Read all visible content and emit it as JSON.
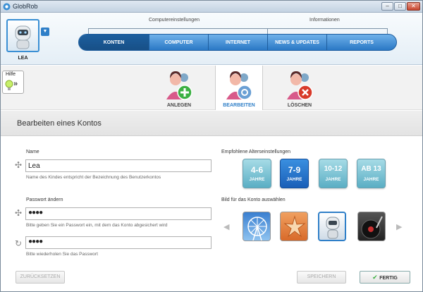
{
  "window": {
    "title": "GlobRob",
    "min_glyph": "–",
    "max_glyph": "□",
    "close_glyph": "✕"
  },
  "user": {
    "name": "LEA",
    "dropdown_glyph": "▼"
  },
  "nav": {
    "groups": [
      "Computereinstellungen",
      "Informationen"
    ],
    "tabs": [
      {
        "label": "KONTEN",
        "active": true
      },
      {
        "label": "COMPUTER",
        "active": false
      },
      {
        "label": "INTERNET",
        "active": false
      },
      {
        "label": "NEWS & UPDATES",
        "active": false
      },
      {
        "label": "REPORTS",
        "active": false
      }
    ]
  },
  "help": {
    "label": "Hilfe",
    "arrow": "»"
  },
  "actions": [
    {
      "label": "ANLEGEN",
      "icon": "user-add-icon"
    },
    {
      "label": "BEARBEITEN",
      "icon": "user-edit-icon",
      "active": true
    },
    {
      "label": "LÖSCHEN",
      "icon": "user-delete-icon"
    }
  ],
  "section_title": "Bearbeiten eines Kontos",
  "form": {
    "name_label": "Name",
    "name_value": "Lea",
    "name_hint": "Name des Kindes entspricht der Bezeichnung des Benutzerkontos",
    "password_label": "Passwort ändern",
    "password_value": "●●●●",
    "password_hint": "Bitte geben Sie ein Passwort ein, mit dem das Konto abgesichert wird",
    "password_repeat_value": "●●●●",
    "password_repeat_hint": "Bitte wiederholen Sie das Passwort"
  },
  "age": {
    "label": "Empfohlene Alterseinstellungen",
    "options": [
      {
        "range": "4-6",
        "unit": "JAHRE",
        "selected": false
      },
      {
        "range": "7-9",
        "unit": "JAHRE",
        "selected": true
      },
      {
        "range": "10-12",
        "unit": "JAHRE",
        "selected": false
      },
      {
        "range": "AB 13",
        "unit": "JAHRE",
        "selected": false
      }
    ]
  },
  "pictures": {
    "label": "Bild für das Konto auswählen",
    "items": [
      "ferris-wheel-icon",
      "starfish-icon",
      "robot-icon",
      "turntable-icon"
    ],
    "selected_index": 2,
    "prev_glyph": "◀",
    "next_glyph": "▶"
  },
  "buttons": {
    "reset": "ZURÜCKSETZEN",
    "save": "SPEICHERN",
    "done": "FERTIG"
  },
  "colors": {
    "accent": "#2f7fc8",
    "nav": "#2a78c5",
    "age_default": "#5aaec4",
    "age_selected": "#1a5fb8"
  }
}
